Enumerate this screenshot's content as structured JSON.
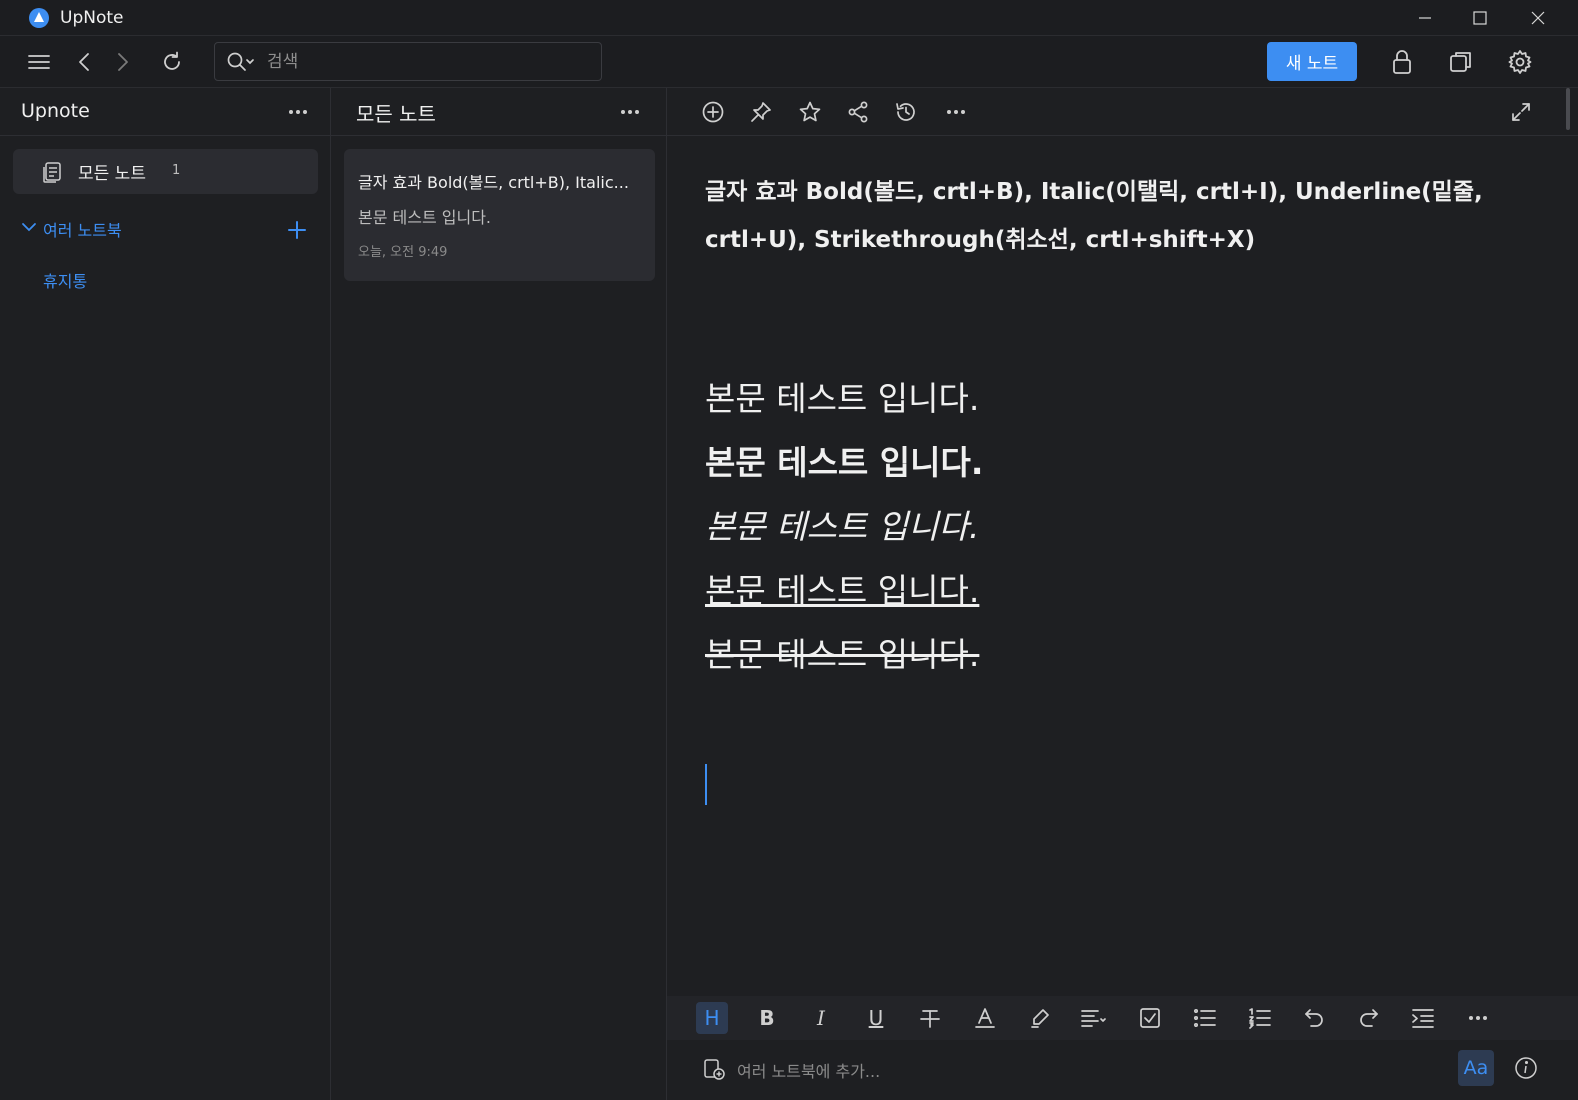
{
  "app": {
    "title": "UpNote"
  },
  "toolbar": {
    "search_placeholder": "검색",
    "new_note_label": "새 노트"
  },
  "sidebar": {
    "title": "Upnote",
    "all_notes_label": "모든 노트",
    "all_notes_count": "1",
    "section_label": "여러 노트북",
    "trash_label": "휴지통"
  },
  "note_list": {
    "title": "모든 노트",
    "notes": [
      {
        "title": "글자 효과 Bold(볼드, crtl+B), Italic...",
        "preview": "본문 테스트 입니다.",
        "date": "오늘, 오전 9:49"
      }
    ]
  },
  "editor": {
    "title": "글자 효과 Bold(볼드, crtl+B), Italic(이탤릭, crtl+I), Underline(밑줄, crtl+U), Strikethrough(취소선, crtl+shift+X)",
    "lines": [
      "본문 테스트 입니다.",
      "본문 테스트 입니다.",
      "본문 테스트 입니다.",
      "본문 테스트 입니다.",
      "본문 테스트 입니다."
    ],
    "add_notebook_placeholder": "여러 노트북에 추가...",
    "font_button_label": "Aa"
  },
  "format_toolbar": {
    "heading_label": "H",
    "bold_label": "B",
    "italic_label": "I",
    "underline_label": "U"
  },
  "colors": {
    "accent": "#3d8ef2",
    "background": "#1e1f22",
    "card": "#2b2c31"
  }
}
